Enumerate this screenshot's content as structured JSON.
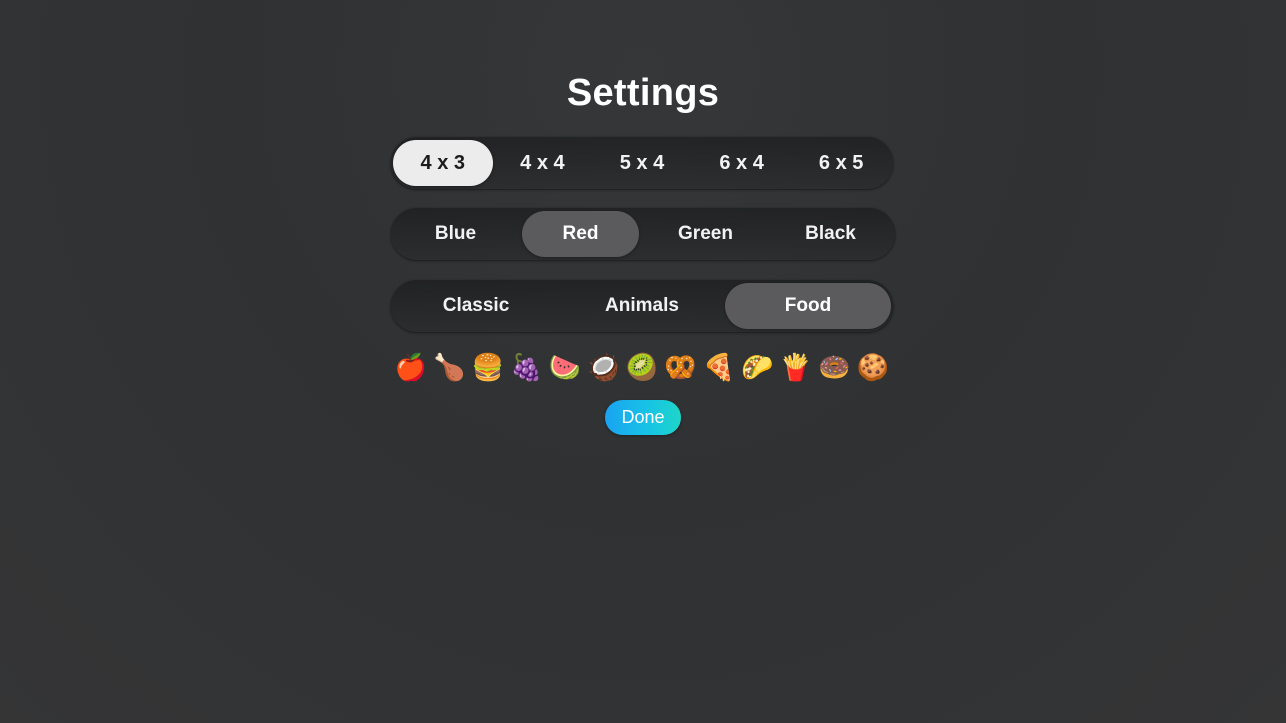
{
  "title": "Settings",
  "grid_sizes": {
    "options": [
      "4 x 3",
      "4 x 4",
      "5 x 4",
      "6 x 4",
      "6 x 5"
    ],
    "selected": "4 x 3"
  },
  "card_colors": {
    "options": [
      "Blue",
      "Red",
      "Green",
      "Black"
    ],
    "selected": "Red"
  },
  "themes": {
    "options": [
      "Classic",
      "Animals",
      "Food"
    ],
    "selected": "Food"
  },
  "theme_preview": [
    "🍎",
    "🍗",
    "🍔",
    "🍇",
    "🍉",
    "🥥",
    "🥝",
    "🥨",
    "🍕",
    "🌮",
    "🍟",
    "🍩",
    "🍪"
  ],
  "done_label": "Done",
  "colors": {
    "background": "#303234",
    "selected_light": "#ececec",
    "selected_dark": "#5b5b5d",
    "done_gradient_start": "#1aa3f0",
    "done_gradient_end": "#1ed6c8"
  }
}
